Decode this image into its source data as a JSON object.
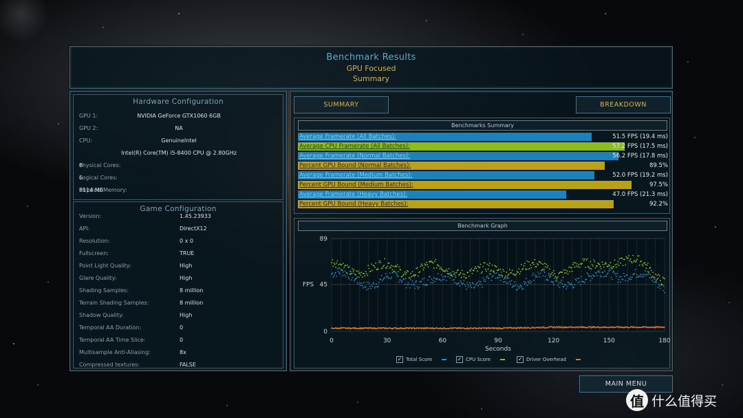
{
  "header": {
    "title": "Benchmark Results",
    "subtitle": "GPU Focused",
    "mode": "Summary"
  },
  "hardware": {
    "title": "Hardware Configuration",
    "rows": [
      {
        "key": "GPU 1:",
        "value": "NVIDIA GeForce GTX1060 6GB"
      },
      {
        "key": "GPU 2:",
        "value": "NA"
      },
      {
        "key": "CPU:",
        "value": "GenuineIntel"
      },
      {
        "key": "",
        "value": "Intel(R) Core(TM) i5-8400 CPU @ 2.80GHz"
      },
      {
        "key": "Physical Cores:",
        "value": "6"
      },
      {
        "key": "Logical Cores:",
        "value": "6"
      },
      {
        "key": "Physical Memory:",
        "value": "8114  MB"
      }
    ]
  },
  "game": {
    "title": "Game Configuration",
    "rows": [
      {
        "key": "Version:",
        "value": "1.45.23933"
      },
      {
        "key": "API:",
        "value": "DirectX12"
      },
      {
        "key": "Resolution:",
        "value": "0 x 0"
      },
      {
        "key": "Fullscreen:",
        "value": "TRUE"
      },
      {
        "key": "Point Light Quality:",
        "value": "High"
      },
      {
        "key": "Glare Quality:",
        "value": "High"
      },
      {
        "key": "Shading Samples:",
        "value": "8 million"
      },
      {
        "key": "Terrain Shading Samples:",
        "value": "8 million"
      },
      {
        "key": "Shadow Quality:",
        "value": "High"
      },
      {
        "key": "Temporal AA Duration:",
        "value": "0"
      },
      {
        "key": "Temporal AA Time Slice:",
        "value": "0"
      },
      {
        "key": "Multisample Anti-Aliasing:",
        "value": "8x"
      },
      {
        "key": "Compressed textures:",
        "value": "FALSE"
      }
    ]
  },
  "tabs": {
    "summary": "SUMMARY",
    "breakdown": "BREAKDOWN"
  },
  "summary": {
    "title": "Benchmarks Summary",
    "scale_max_fps": 60,
    "rows": [
      {
        "label": "Average Framerate (All Batches):",
        "value": "51.5 FPS (19.4 ms)",
        "color": "blue",
        "level": 51.5
      },
      {
        "label": "Average CPU Framerate (All Batches):",
        "value": "57.2 FPS (17.5 ms)",
        "color": "green",
        "level": 57.2
      },
      {
        "label": "Average Framerate (Normal Batches):",
        "value": "56.2 FPS (17.8 ms)",
        "color": "blue",
        "level": 56.2
      },
      {
        "label": "Percent GPU Bound (Normal Batches):",
        "value": "89.5%",
        "color": "gold",
        "level": 89.5
      },
      {
        "label": "Average Framerate (Medium Batches):",
        "value": "52.0 FPS (19.2 ms)",
        "color": "blue",
        "level": 52.0
      },
      {
        "label": "Percent GPU Bound (Medium Batches):",
        "value": "97.5%",
        "color": "gold",
        "level": 97.5
      },
      {
        "label": "Average Framerate (Heavy Batches):",
        "value": "47.0 FPS (21.3 ms)",
        "color": "blue",
        "level": 47.0
      },
      {
        "label": "Percent GPU Bound (Heavy Batches):",
        "value": "92.2%",
        "color": "gold",
        "level": 92.2
      }
    ]
  },
  "graph": {
    "title": "Benchmark Graph",
    "ylabel": "FPS",
    "xlabel": "Seconds",
    "y_ticks": [
      "89",
      "45",
      "0"
    ],
    "x_ticks": [
      "0",
      "30",
      "60",
      "90",
      "120",
      "150",
      "180"
    ],
    "legend": [
      {
        "label": "Total Score",
        "color": "#2a8fc9",
        "checked": true
      },
      {
        "label": "CPU Score",
        "color": "#8cc21c",
        "checked": true
      },
      {
        "label": "Driver Overhead",
        "color": "#e07828",
        "checked": true
      }
    ],
    "check_mark": "✓"
  },
  "chart_data": {
    "type": "scatter",
    "title": "Benchmark Graph",
    "xlabel": "Seconds",
    "ylabel": "FPS",
    "xlim": [
      0,
      180
    ],
    "ylim": [
      0,
      89
    ],
    "series": [
      {
        "name": "Total Score",
        "color": "#2a8fc9",
        "x": [
          0,
          10,
          20,
          30,
          40,
          50,
          60,
          70,
          80,
          90,
          100,
          110,
          120,
          130,
          140,
          150,
          160,
          170,
          180
        ],
        "values": [
          55,
          50,
          48,
          50,
          46,
          52,
          48,
          50,
          45,
          50,
          48,
          52,
          46,
          50,
          48,
          58,
          55,
          50,
          45
        ]
      },
      {
        "name": "CPU Score",
        "color": "#8cc21c",
        "x": [
          0,
          10,
          20,
          30,
          40,
          50,
          60,
          70,
          80,
          90,
          100,
          110,
          120,
          130,
          140,
          150,
          160,
          170,
          180
        ],
        "values": [
          62,
          58,
          62,
          60,
          58,
          62,
          58,
          60,
          56,
          58,
          62,
          60,
          58,
          62,
          60,
          70,
          66,
          62,
          52
        ]
      },
      {
        "name": "Driver Overhead",
        "color": "#e07828",
        "x": [
          0,
          30,
          60,
          90,
          120,
          150,
          180
        ],
        "values": [
          3,
          3,
          3,
          3,
          4,
          4,
          4
        ]
      }
    ]
  },
  "main_menu": "MAIN MENU",
  "watermark": {
    "logo": "值",
    "text": "什么值得买"
  }
}
